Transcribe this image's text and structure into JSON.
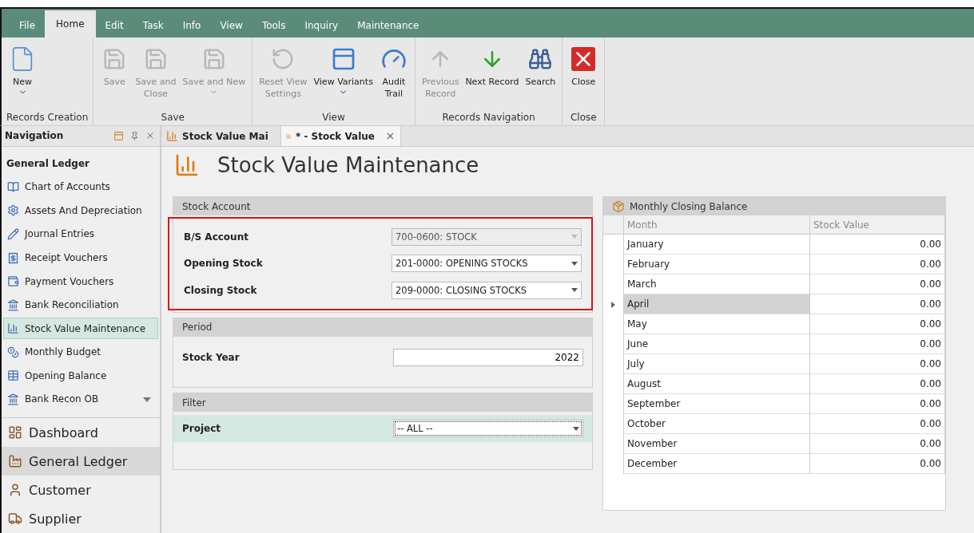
{
  "menu": [
    {
      "label": "File",
      "selected": false
    },
    {
      "label": "Home",
      "selected": true
    },
    {
      "label": "Edit",
      "selected": false
    },
    {
      "label": "Task",
      "selected": false
    },
    {
      "label": "Info",
      "selected": false
    },
    {
      "label": "View",
      "selected": false
    },
    {
      "label": "Tools",
      "selected": false
    },
    {
      "label": "Inquiry",
      "selected": false
    },
    {
      "label": "Maintenance",
      "selected": false
    }
  ],
  "ribbon": [
    {
      "label": "Records Creation",
      "buttons": [
        {
          "lines": [
            "New"
          ],
          "disabled": false,
          "dropdown": true
        }
      ]
    },
    {
      "label": "Save",
      "buttons": [
        {
          "lines": [
            "Save"
          ],
          "disabled": true,
          "dropdown": false
        },
        {
          "lines": [
            "Save and",
            "Close"
          ],
          "disabled": true,
          "dropdown": false
        },
        {
          "lines": [
            "Save and New"
          ],
          "disabled": true,
          "dropdown": true
        }
      ]
    },
    {
      "label": "View",
      "buttons": [
        {
          "lines": [
            "Reset View",
            "Settings"
          ],
          "disabled": true,
          "dropdown": false
        },
        {
          "lines": [
            "View Variants"
          ],
          "disabled": false,
          "dropdown": true
        },
        {
          "lines": [
            "Audit",
            "Trail"
          ],
          "disabled": false,
          "dropdown": false
        }
      ]
    },
    {
      "label": "Records Navigation",
      "buttons": [
        {
          "lines": [
            "Previous",
            "Record"
          ],
          "disabled": true,
          "dropdown": false
        },
        {
          "lines": [
            "Next Record"
          ],
          "disabled": false,
          "dropdown": false
        },
        {
          "lines": [
            "Search"
          ],
          "disabled": false,
          "dropdown": false
        }
      ]
    },
    {
      "label": "Close",
      "buttons": [
        {
          "lines": [
            "Close"
          ],
          "disabled": false,
          "dropdown": false
        }
      ]
    }
  ],
  "navigation": {
    "title": "Navigation",
    "module_title": "General Ledger",
    "items": [
      {
        "label": "Chart of Accounts",
        "selected": false
      },
      {
        "label": "Assets And Depreciation",
        "selected": false
      },
      {
        "label": "Journal Entries",
        "selected": false
      },
      {
        "label": "Receipt Vouchers",
        "selected": false
      },
      {
        "label": "Payment Vouchers",
        "selected": false
      },
      {
        "label": "Bank Reconciliation",
        "selected": false
      },
      {
        "label": "Stock Value Maintenance",
        "selected": true
      },
      {
        "label": "Monthly Budget",
        "selected": false
      },
      {
        "label": "Opening Balance",
        "selected": false
      },
      {
        "label": "Bank Recon OB",
        "selected": false
      }
    ],
    "modules": [
      {
        "label": "Dashboard",
        "selected": false
      },
      {
        "label": "General Ledger",
        "selected": true
      },
      {
        "label": "Customer",
        "selected": false
      },
      {
        "label": "Supplier",
        "selected": false
      }
    ]
  },
  "tabs": [
    {
      "label": "Stock Value Mai",
      "selected": false
    },
    {
      "label": "* - Stock Value",
      "selected": true
    }
  ],
  "page_title": "Stock Value Maintenance",
  "stock_account": {
    "title": "Stock Account",
    "highlighted": true,
    "fields": [
      {
        "label": "B/S Account",
        "value": "700-0600: STOCK",
        "disabled": true
      },
      {
        "label": "Opening Stock",
        "value": "201-0000: OPENING STOCKS",
        "disabled": false
      },
      {
        "label": "Closing Stock",
        "value": "209-0000: CLOSING STOCKS",
        "disabled": false
      }
    ]
  },
  "period": {
    "title": "Period",
    "label": "Stock Year",
    "value": "2022"
  },
  "filter": {
    "title": "Filter",
    "label": "Project",
    "value": "-- ALL --",
    "focused": true
  },
  "grid": {
    "title": "Monthly Closing Balance",
    "columns": [
      "Month",
      "Stock Value"
    ],
    "rows": [
      {
        "month": "January",
        "stock_value": "0.00",
        "selected": false
      },
      {
        "month": "February",
        "stock_value": "0.00",
        "selected": false
      },
      {
        "month": "March",
        "stock_value": "0.00",
        "selected": false
      },
      {
        "month": "April",
        "stock_value": "0.00",
        "selected": true
      },
      {
        "month": "May",
        "stock_value": "0.00",
        "selected": false
      },
      {
        "month": "June",
        "stock_value": "0.00",
        "selected": false
      },
      {
        "month": "July",
        "stock_value": "0.00",
        "selected": false
      },
      {
        "month": "August",
        "stock_value": "0.00",
        "selected": false
      },
      {
        "month": "September",
        "stock_value": "0.00",
        "selected": false
      },
      {
        "month": "October",
        "stock_value": "0.00",
        "selected": false
      },
      {
        "month": "November",
        "stock_value": "0.00",
        "selected": false
      },
      {
        "month": "December",
        "stock_value": "0.00",
        "selected": false
      }
    ]
  }
}
